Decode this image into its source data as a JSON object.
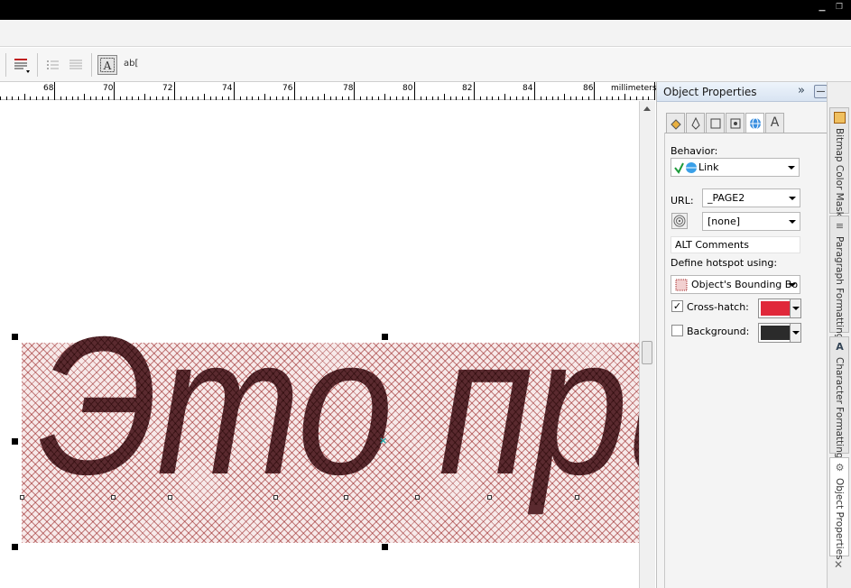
{
  "ruler": {
    "labels": [
      "68",
      "70",
      "72",
      "74",
      "76",
      "78",
      "80",
      "82",
      "84",
      "86"
    ],
    "unit": "millimeters"
  },
  "canvas": {
    "text": "Это приме",
    "hatch_color": "#9a1e1e",
    "text_color": "#5a2a2f"
  },
  "toolbar": {
    "ab_label": "ab["
  },
  "panel": {
    "title": "Object Properties",
    "behavior_label": "Behavior:",
    "behavior_value": "Link",
    "url_label": "URL:",
    "url_value": "_PAGE2",
    "target_value": "[none]",
    "alt_placeholder": "ALT Comments",
    "hotspot_label": "Define hotspot using:",
    "hotspot_value": "Object's Bounding Bo",
    "crosshatch_label": "Cross-hatch:",
    "crosshatch_checked": true,
    "crosshatch_color": "#e0283a",
    "background_label": "Background:",
    "background_checked": false,
    "background_color": "#2b2b2b"
  },
  "docker_tabs": [
    {
      "label": "Bitmap Color Mask",
      "icon": "bitmap-mask-icon"
    },
    {
      "label": "Paragraph Formatting",
      "icon": "paragraph-icon"
    },
    {
      "label": "Character Formatting",
      "icon": "character-icon"
    },
    {
      "label": "Object Properties",
      "icon": "object-properties-icon",
      "active": true
    }
  ]
}
